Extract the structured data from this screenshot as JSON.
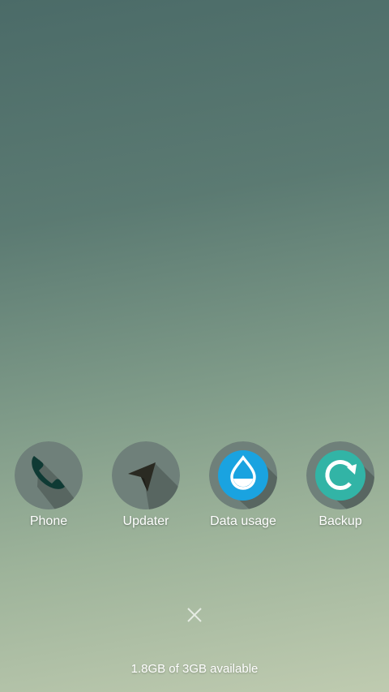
{
  "recents": {
    "apps": [
      {
        "label": "Phone",
        "icon": "phone-icon"
      },
      {
        "label": "Updater",
        "icon": "updater-icon"
      },
      {
        "label": "Data usage",
        "icon": "data-usage-icon"
      },
      {
        "label": "Backup",
        "icon": "backup-icon"
      }
    ],
    "close_icon": "close-icon",
    "memory_text": "1.8GB of 3GB available"
  },
  "colors": {
    "icon_circle": "#6f807a",
    "long_shadow": "#55615d",
    "phone_glyph": "#0f3a34",
    "updater_glyph": "#2a2a22",
    "data_usage_blue": "#1aa3e0",
    "backup_teal": "#32b4a6"
  }
}
